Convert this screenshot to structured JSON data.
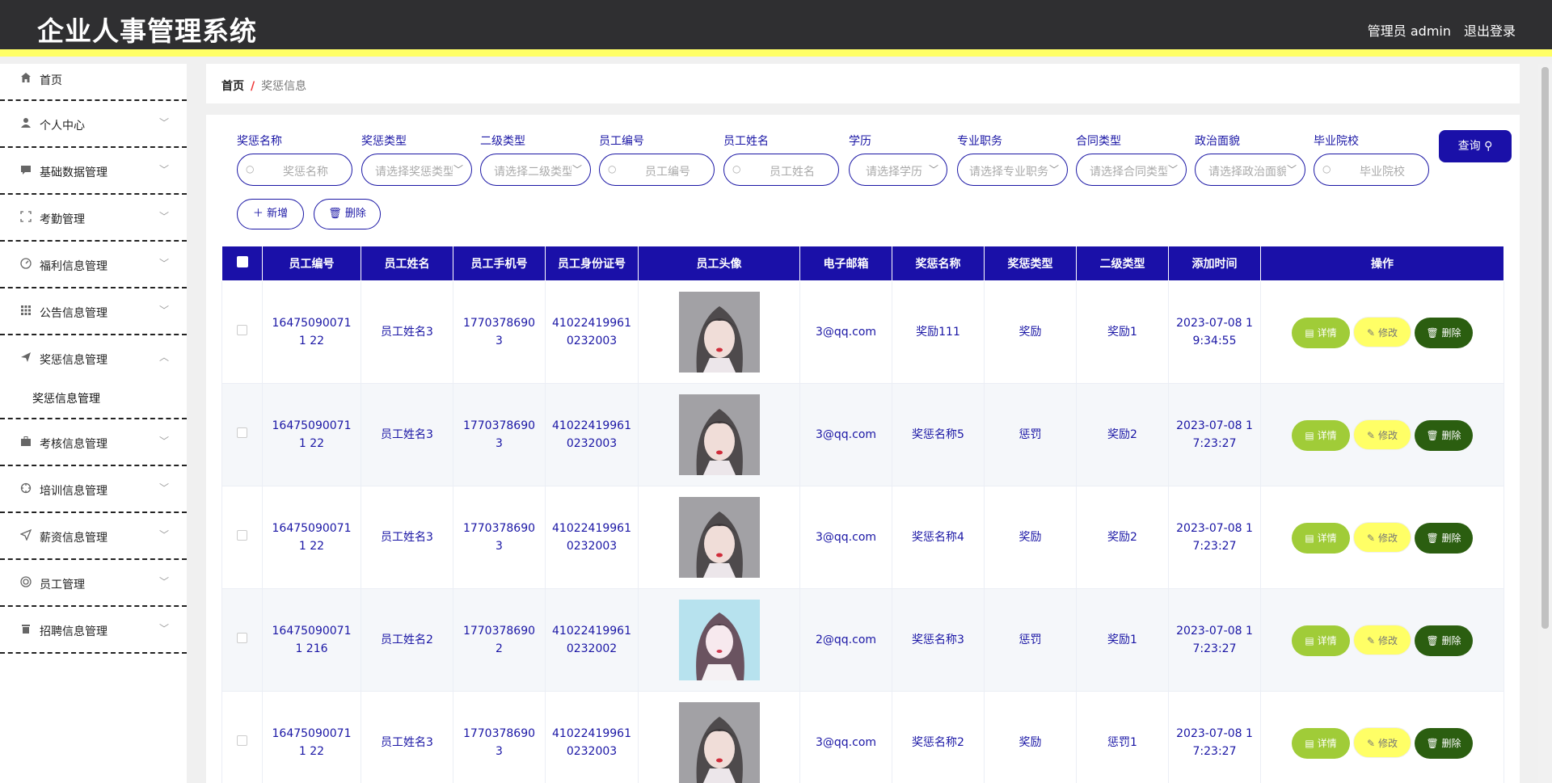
{
  "header": {
    "title": "企业人事管理系统",
    "user": "管理员 admin",
    "logout": "退出登录"
  },
  "sidebar": {
    "items": [
      {
        "label": "首页",
        "icon": "home-icon"
      },
      {
        "label": "个人中心",
        "icon": "user-icon"
      },
      {
        "label": "基础数据管理",
        "icon": "message-icon"
      },
      {
        "label": "考勤管理",
        "icon": "scan-icon"
      },
      {
        "label": "福利信息管理",
        "icon": "gauge-icon"
      },
      {
        "label": "公告信息管理",
        "icon": "grid-icon"
      },
      {
        "label": "奖惩信息管理",
        "icon": "send-icon",
        "sub": "奖惩信息管理"
      },
      {
        "label": "考核信息管理",
        "icon": "briefcase-icon"
      },
      {
        "label": "培训信息管理",
        "icon": "crosshair-icon"
      },
      {
        "label": "薪资信息管理",
        "icon": "paper-plane-icon"
      },
      {
        "label": "员工管理",
        "icon": "circle-icon"
      },
      {
        "label": "招聘信息管理",
        "icon": "trash-icon"
      }
    ]
  },
  "breadcrumb": {
    "home": "首页",
    "current": "奖惩信息"
  },
  "filters": [
    {
      "label": "奖惩名称",
      "placeholder": "奖惩名称",
      "kind": "input"
    },
    {
      "label": "奖惩类型",
      "placeholder": "请选择奖惩类型",
      "kind": "select"
    },
    {
      "label": "二级类型",
      "placeholder": "请选择二级类型",
      "kind": "select"
    },
    {
      "label": "员工编号",
      "placeholder": "员工编号",
      "kind": "input"
    },
    {
      "label": "员工姓名",
      "placeholder": "员工姓名",
      "kind": "input"
    },
    {
      "label": "学历",
      "placeholder": "请选择学历",
      "kind": "select"
    },
    {
      "label": "专业职务",
      "placeholder": "请选择专业职务",
      "kind": "select"
    },
    {
      "label": "合同类型",
      "placeholder": "请选择合同类型",
      "kind": "select"
    },
    {
      "label": "政治面貌",
      "placeholder": "请选择政治面貌",
      "kind": "select"
    },
    {
      "label": "毕业院校",
      "placeholder": "毕业院校",
      "kind": "input"
    }
  ],
  "search_label": "查询",
  "add_label": "新增",
  "delete_label": "删除",
  "table": {
    "headers": [
      "员工编号",
      "员工姓名",
      "员工手机号",
      "员工身份证号",
      "员工头像",
      "电子邮箱",
      "奖惩名称",
      "奖惩类型",
      "二级类型",
      "添加时间",
      "操作"
    ],
    "rows": [
      [
        "164750900711 22",
        "员工姓名3",
        "17703786903",
        "41022419961 0232003",
        "avatar-1",
        "3@qq.com",
        "奖励111",
        "奖励",
        "奖励1",
        "2023-07-08 1 9:34:55"
      ],
      [
        "164750900711 22",
        "员工姓名3",
        "17703786903",
        "41022419961 0232003",
        "avatar-1",
        "3@qq.com",
        "奖惩名称5",
        "惩罚",
        "奖励2",
        "2023-07-08 1 7:23:27"
      ],
      [
        "164750900711 22",
        "员工姓名3",
        "17703786903",
        "41022419961 0232003",
        "avatar-1",
        "3@qq.com",
        "奖惩名称4",
        "奖励",
        "奖励2",
        "2023-07-08 1 7:23:27"
      ],
      [
        "164750900711 216",
        "员工姓名2",
        "17703786902",
        "41022419961 0232002",
        "avatar-2",
        "2@qq.com",
        "奖惩名称3",
        "惩罚",
        "奖励1",
        "2023-07-08 1 7:23:27"
      ],
      [
        "164750900711 22",
        "员工姓名3",
        "17703786903",
        "41022419961 0232003",
        "avatar-1",
        "3@qq.com",
        "奖惩名称2",
        "奖励",
        "惩罚1",
        "2023-07-08 1 7:23:27"
      ]
    ],
    "row_actions": {
      "detail": "详情",
      "edit": "修改",
      "delete": "删除"
    }
  },
  "colors": {
    "header_bg": "#2f2f31",
    "accent_yellow": "#ffff66",
    "primary": "#1a10a8",
    "detail_btn": "#a0cc38",
    "delete_btn": "#2b5e10"
  }
}
